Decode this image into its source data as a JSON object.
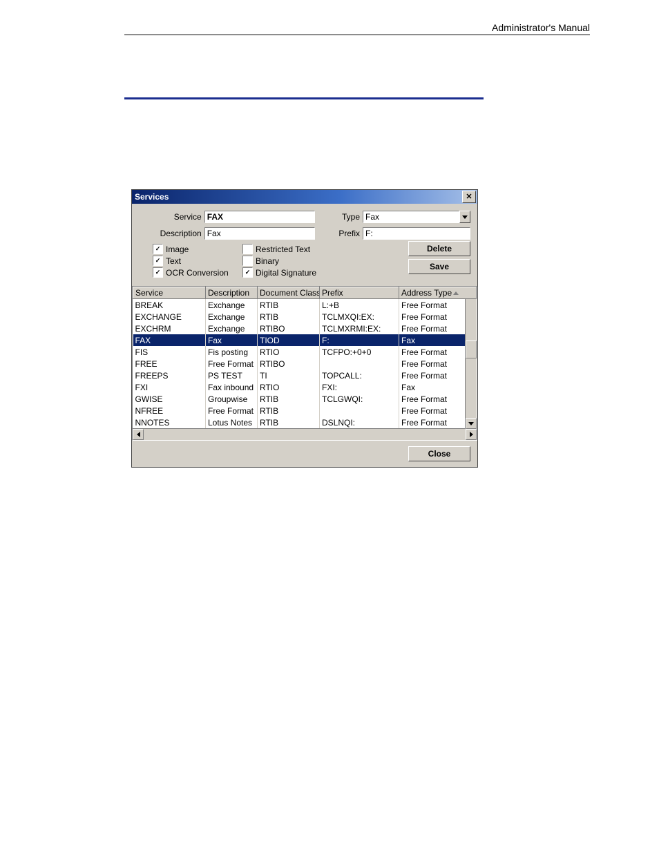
{
  "header": {
    "right": "Administrator's Manual"
  },
  "dialog": {
    "title": "Services",
    "labels": {
      "service": "Service",
      "description": "Description",
      "type": "Type",
      "prefix": "Prefix"
    },
    "values": {
      "service": "FAX",
      "description": "Fax",
      "type": "Fax",
      "prefix": "F:"
    },
    "checks": {
      "image": {
        "label": "Image",
        "checked": true
      },
      "restricted": {
        "label": "Restricted Text",
        "checked": false
      },
      "text": {
        "label": "Text",
        "checked": true
      },
      "binary": {
        "label": "Binary",
        "checked": false
      },
      "ocr": {
        "label": "OCR Conversion",
        "checked": true
      },
      "digsig": {
        "label": "Digital Signature",
        "checked": true
      }
    },
    "buttons": {
      "delete": "Delete",
      "save": "Save",
      "close": "Close"
    },
    "columns": [
      "Service",
      "Description",
      "Document Class",
      "Prefix",
      "Address Type"
    ],
    "rows": [
      {
        "svc": "BREAK",
        "desc": "Exchange",
        "cls": "RTIB",
        "pfx": "L:+B",
        "at": "Free Format",
        "sel": false
      },
      {
        "svc": "EXCHANGE",
        "desc": "Exchange",
        "cls": "RTIB",
        "pfx": "TCLMXQI:EX:",
        "at": "Free Format",
        "sel": false
      },
      {
        "svc": "EXCHRM",
        "desc": "Exchange",
        "cls": "RTIBO",
        "pfx": "TCLMXRMI:EX:",
        "at": "Free Format",
        "sel": false
      },
      {
        "svc": "FAX",
        "desc": "Fax",
        "cls": "TIOD",
        "pfx": "F:",
        "at": "Fax",
        "sel": true
      },
      {
        "svc": "FIS",
        "desc": "Fis posting",
        "cls": "RTIO",
        "pfx": "TCFPO:+0+0",
        "at": "Free Format",
        "sel": false
      },
      {
        "svc": "FREE",
        "desc": "Free Format",
        "cls": "RTIBO",
        "pfx": "",
        "at": "Free Format",
        "sel": false
      },
      {
        "svc": "FREEPS",
        "desc": "PS TEST",
        "cls": "TI",
        "pfx": "TOPCALL:",
        "at": "Free Format",
        "sel": false
      },
      {
        "svc": "FXI",
        "desc": "Fax inbound",
        "cls": "RTIO",
        "pfx": "FXI:",
        "at": "Fax",
        "sel": false
      },
      {
        "svc": "GWISE",
        "desc": "Groupwise",
        "cls": "RTIB",
        "pfx": "TCLGWQI:",
        "at": "Free Format",
        "sel": false
      },
      {
        "svc": "NFREE",
        "desc": "Free Format",
        "cls": "RTIB",
        "pfx": "",
        "at": "Free Format",
        "sel": false
      },
      {
        "svc": "NNOTES",
        "desc": "Lotus Notes",
        "cls": "RTIB",
        "pfx": "DSLNQI:",
        "at": "Free Format",
        "sel": false
      }
    ]
  }
}
